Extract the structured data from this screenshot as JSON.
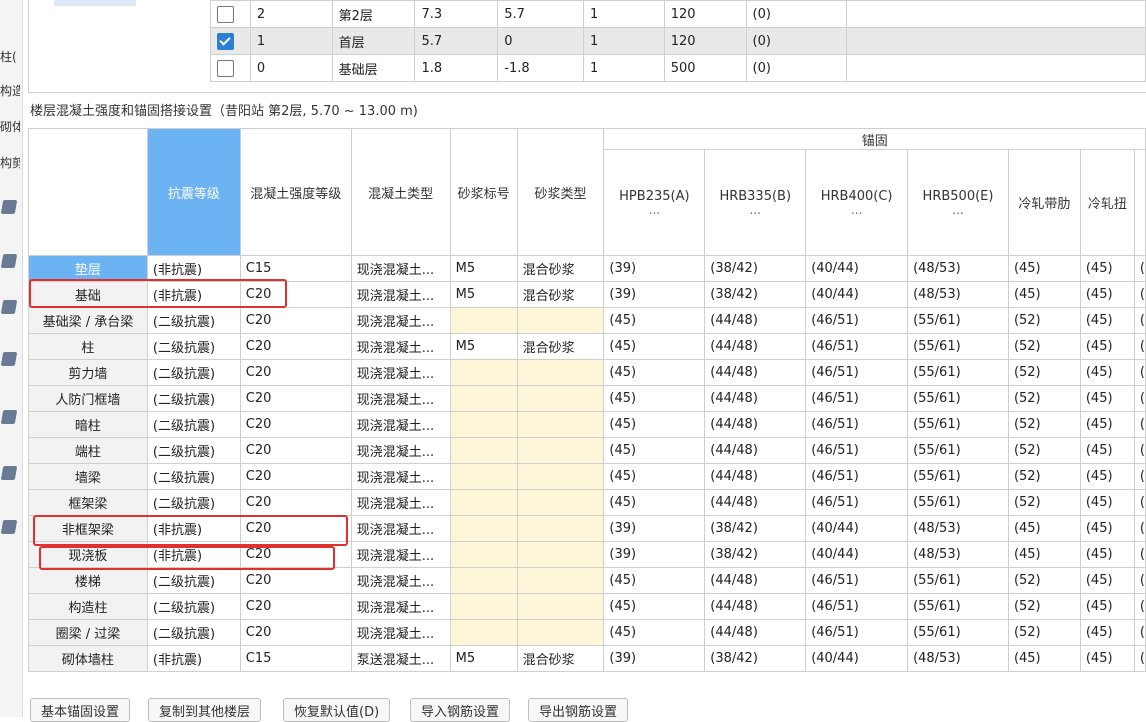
{
  "left_strip": {
    "chars": [
      "柱(",
      "构造",
      "砌体",
      "构剪"
    ],
    "icons": [
      "beam-icon",
      "column-icon",
      "wall-icon",
      "slab-icon",
      "stair-icon",
      "opening-icon",
      "foundation-icon"
    ]
  },
  "floors": [
    {
      "checked": false,
      "num": "2",
      "name": "第2层",
      "height": "7.3",
      "bottom": "5.7",
      "same_count": "1",
      "slab_thickness": "120",
      "area": "(0)"
    },
    {
      "checked": true,
      "num": "1",
      "name": "首层",
      "height": "5.7",
      "bottom": "0",
      "same_count": "1",
      "slab_thickness": "120",
      "area": "(0)"
    },
    {
      "checked": false,
      "num": "0",
      "name": "基础层",
      "height": "1.8",
      "bottom": "-1.8",
      "same_count": "1",
      "slab_thickness": "500",
      "area": "(0)"
    }
  ],
  "section_title": "楼层混凝土强度和锚固搭接设置（昔阳站  第2层, 5.70 ~ 13.00 m)",
  "columns": {
    "seismic": "抗震等级",
    "concrete_grade": "混凝土强度等级",
    "concrete_type": "混凝土类型",
    "mortar_grade": "砂浆标号",
    "mortar_type": "砂浆类型",
    "anchor_group": "锚固",
    "hpb235": "HPB235(A)",
    "hrb335": "HRB335(B)",
    "hrb400": "HRB400(C)",
    "hrb500": "HRB500(E)",
    "ellipsis": "...",
    "cold_rolled_ribbed": "冷轧带肋",
    "cold_rolled_twisted": "冷轧扭"
  },
  "rows": [
    {
      "name": "垫层",
      "seismic": "(非抗震)",
      "grade": "C15",
      "ctype": "现浇混凝土...",
      "mortar": "M5",
      "mtype": "混合砂浆",
      "a": "(39)",
      "b": "(38/42)",
      "c": "(40/44)",
      "e": "(48/53)",
      "crb": "(45)",
      "crt": "(45)",
      "extra": "("
    },
    {
      "name": "基础",
      "seismic": "(非抗震)",
      "grade": "C20",
      "ctype": "现浇混凝土...",
      "mortar": "M5",
      "mtype": "混合砂浆",
      "a": "(39)",
      "b": "(38/42)",
      "c": "(40/44)",
      "e": "(48/53)",
      "crb": "(45)",
      "crt": "(45)",
      "extra": "("
    },
    {
      "name": "基础梁 / 承台梁",
      "seismic": "(二级抗震)",
      "grade": "C20",
      "ctype": "现浇混凝土...",
      "mortar": "",
      "mtype": "",
      "a": "(45)",
      "b": "(44/48)",
      "c": "(46/51)",
      "e": "(55/61)",
      "crb": "(52)",
      "crt": "(45)",
      "extra": "("
    },
    {
      "name": "柱",
      "seismic": "(二级抗震)",
      "grade": "C20",
      "ctype": "现浇混凝土...",
      "mortar": "M5",
      "mtype": "混合砂浆",
      "a": "(45)",
      "b": "(44/48)",
      "c": "(46/51)",
      "e": "(55/61)",
      "crb": "(52)",
      "crt": "(45)",
      "extra": "("
    },
    {
      "name": "剪力墙",
      "seismic": "(二级抗震)",
      "grade": "C20",
      "ctype": "现浇混凝土...",
      "mortar": "",
      "mtype": "",
      "a": "(45)",
      "b": "(44/48)",
      "c": "(46/51)",
      "e": "(55/61)",
      "crb": "(52)",
      "crt": "(45)",
      "extra": "("
    },
    {
      "name": "人防门框墙",
      "seismic": "(二级抗震)",
      "grade": "C20",
      "ctype": "现浇混凝土...",
      "mortar": "",
      "mtype": "",
      "a": "(45)",
      "b": "(44/48)",
      "c": "(46/51)",
      "e": "(55/61)",
      "crb": "(52)",
      "crt": "(45)",
      "extra": "("
    },
    {
      "name": "暗柱",
      "seismic": "(二级抗震)",
      "grade": "C20",
      "ctype": "现浇混凝土...",
      "mortar": "",
      "mtype": "",
      "a": "(45)",
      "b": "(44/48)",
      "c": "(46/51)",
      "e": "(55/61)",
      "crb": "(52)",
      "crt": "(45)",
      "extra": "("
    },
    {
      "name": "端柱",
      "seismic": "(二级抗震)",
      "grade": "C20",
      "ctype": "现浇混凝土...",
      "mortar": "",
      "mtype": "",
      "a": "(45)",
      "b": "(44/48)",
      "c": "(46/51)",
      "e": "(55/61)",
      "crb": "(52)",
      "crt": "(45)",
      "extra": "("
    },
    {
      "name": "墙梁",
      "seismic": "(二级抗震)",
      "grade": "C20",
      "ctype": "现浇混凝土...",
      "mortar": "",
      "mtype": "",
      "a": "(45)",
      "b": "(44/48)",
      "c": "(46/51)",
      "e": "(55/61)",
      "crb": "(52)",
      "crt": "(45)",
      "extra": "("
    },
    {
      "name": "框架梁",
      "seismic": "(二级抗震)",
      "grade": "C20",
      "ctype": "现浇混凝土...",
      "mortar": "",
      "mtype": "",
      "a": "(45)",
      "b": "(44/48)",
      "c": "(46/51)",
      "e": "(55/61)",
      "crb": "(52)",
      "crt": "(45)",
      "extra": "("
    },
    {
      "name": "非框架梁",
      "seismic": "(非抗震)",
      "grade": "C20",
      "ctype": "现浇混凝土...",
      "mortar": "",
      "mtype": "",
      "a": "(39)",
      "b": "(38/42)",
      "c": "(40/44)",
      "e": "(48/53)",
      "crb": "(45)",
      "crt": "(45)",
      "extra": "("
    },
    {
      "name": "现浇板",
      "seismic": "(非抗震)",
      "grade": "C20",
      "ctype": "现浇混凝土...",
      "mortar": "",
      "mtype": "",
      "a": "(39)",
      "b": "(38/42)",
      "c": "(40/44)",
      "e": "(48/53)",
      "crb": "(45)",
      "crt": "(45)",
      "extra": "("
    },
    {
      "name": "楼梯",
      "seismic": "(二级抗震)",
      "grade": "C20",
      "ctype": "现浇混凝土...",
      "mortar": "",
      "mtype": "",
      "a": "(45)",
      "b": "(44/48)",
      "c": "(46/51)",
      "e": "(55/61)",
      "crb": "(52)",
      "crt": "(45)",
      "extra": "("
    },
    {
      "name": "构造柱",
      "seismic": "(二级抗震)",
      "grade": "C20",
      "ctype": "现浇混凝土...",
      "mortar": "",
      "mtype": "",
      "a": "(45)",
      "b": "(44/48)",
      "c": "(46/51)",
      "e": "(55/61)",
      "crb": "(52)",
      "crt": "(45)",
      "extra": "("
    },
    {
      "name": "圈梁 / 过梁",
      "seismic": "(二级抗震)",
      "grade": "C20",
      "ctype": "现浇混凝土...",
      "mortar": "",
      "mtype": "",
      "a": "(45)",
      "b": "(44/48)",
      "c": "(46/51)",
      "e": "(55/61)",
      "crb": "(52)",
      "crt": "(45)",
      "extra": "("
    },
    {
      "name": "砌体墙柱",
      "seismic": "(非抗震)",
      "grade": "C15",
      "ctype": "泵送混凝土...",
      "mortar": "M5",
      "mtype": "混合砂浆",
      "a": "(39)",
      "b": "(38/42)",
      "c": "(40/44)",
      "e": "(48/53)",
      "crb": "(45)",
      "crt": "(45)",
      "extra": "("
    }
  ],
  "buttons": [
    "基本锚固设置",
    "复制到其他楼层",
    "恢复默认值(D)",
    "导入钢筋设置",
    "导出钢筋设置"
  ],
  "colors": {
    "header_selected": "#6bb3f3",
    "highlight": "#e03030",
    "empty_cell": "#fdf6d8",
    "checkbox": "#2d7fd6"
  }
}
